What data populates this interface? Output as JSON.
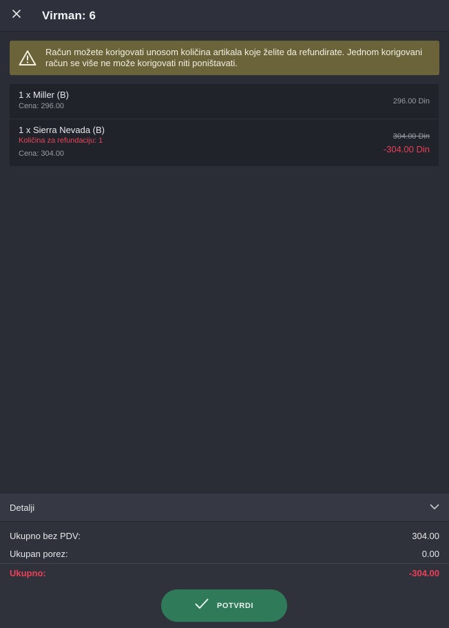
{
  "header": {
    "title": "Virman: 6",
    "close_icon": "close-icon"
  },
  "warning": {
    "icon": "warning-triangle-icon",
    "text_line1": "Račun možete korigovati unosom količina artikala koje želite da refundirate. Jednom korigovani",
    "text_line2": "račun se više ne može korigovati niti poništavati.",
    "color": "#6b6339"
  },
  "items": [
    {
      "name": "1 x Miller (B)",
      "price": "Cena: 296.00",
      "total": "296.00 Din"
    },
    {
      "name": "1 x Sierra Nevada (B)",
      "refund": "Količina za refundaciju: 1",
      "price": "Cena: 304.00",
      "total_original": "304.00 Din",
      "total_refund": "-304.00 Din"
    }
  ],
  "details": {
    "label": "Detalji",
    "icon": "chevron-down-icon"
  },
  "summary": {
    "net_label": "Ukupno bez PDV:",
    "net_value": "304.00",
    "tax_label": "Ukupan porez:",
    "tax_value": "0.00",
    "total_label": "Ukupno:",
    "total_value": "-304.00"
  },
  "confirm": {
    "label": "POTVRDI",
    "icon": "check-icon",
    "color": "#2e7a59"
  },
  "colors": {
    "background": "#2a2d36",
    "negative": "#ec3f58"
  }
}
